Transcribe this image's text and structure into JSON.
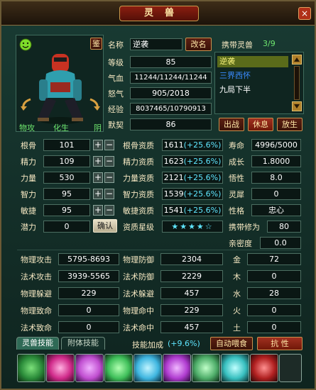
{
  "window": {
    "title": "灵兽",
    "close_label": "×"
  },
  "left": {
    "appraise_label": "鉴",
    "element_type": "物攻",
    "evolve_label": "化生",
    "element_yin": "阴"
  },
  "info": {
    "name_label": "名称",
    "name_value": "逆袭",
    "rename_label": "改名",
    "level_label": "等级",
    "level_value": "85",
    "hp_label": "气血",
    "hp_value": "11244/11244/11244",
    "rage_label": "怒气",
    "rage_value": "905/2018",
    "exp_label": "经验",
    "exp_value": "8037465/10790913",
    "tacit_label": "默契",
    "tacit_value": "86"
  },
  "carry": {
    "title": "携带灵兽",
    "count": "3/9",
    "items": [
      {
        "name": "逆袭",
        "color": "#f7f27a"
      },
      {
        "name": "三界西怀",
        "color": "#3a8cff"
      },
      {
        "name": "九局下半",
        "color": "#ffffff"
      }
    ]
  },
  "actions": {
    "battle": "出战",
    "rest": "休息",
    "release": "放生"
  },
  "base_stats": [
    {
      "label": "根骨",
      "value": "101"
    },
    {
      "label": "精力",
      "value": "109"
    },
    {
      "label": "力量",
      "value": "530"
    },
    {
      "label": "智力",
      "value": "95"
    },
    {
      "label": "敏捷",
      "value": "95"
    }
  ],
  "potential": {
    "label": "潜力",
    "value": "0",
    "confirm": "确认"
  },
  "aptitudes": [
    {
      "label": "根骨资质",
      "value": "1611",
      "bonus": "(+25.6%)"
    },
    {
      "label": "精力资质",
      "value": "1623",
      "bonus": "(+25.6%)"
    },
    {
      "label": "力量资质",
      "value": "2121",
      "bonus": "(+25.6%)"
    },
    {
      "label": "智力资质",
      "value": "1539",
      "bonus": "(+25.6%)"
    },
    {
      "label": "敏捷资质",
      "value": "1541",
      "bonus": "(+25.6%)"
    }
  ],
  "star_level": {
    "label": "资质星级",
    "stars": "★★★★☆"
  },
  "right_stats": [
    {
      "label": "寿命",
      "value": "4996/5000"
    },
    {
      "label": "成长",
      "value": "1.8000"
    },
    {
      "label": "悟性",
      "value": "8.0"
    },
    {
      "label": "灵犀",
      "value": "0"
    },
    {
      "label": "性格",
      "value": "忠心"
    },
    {
      "label": "携带修为",
      "value": "80"
    },
    {
      "label": "亲密度",
      "value": "0.0"
    }
  ],
  "combat_left": [
    {
      "label": "物理攻击",
      "value": "5795-8693"
    },
    {
      "label": "法术攻击",
      "value": "3939-5565"
    },
    {
      "label": "物理躲避",
      "value": "229"
    },
    {
      "label": "物理致命",
      "value": "0"
    },
    {
      "label": "法术致命",
      "value": "0"
    }
  ],
  "combat_mid": [
    {
      "label": "物理防御",
      "value": "2304"
    },
    {
      "label": "法术防御",
      "value": "2229"
    },
    {
      "label": "法术躲避",
      "value": "457"
    },
    {
      "label": "物理命中",
      "value": "229"
    },
    {
      "label": "法术命中",
      "value": "457"
    }
  ],
  "elements": [
    {
      "label": "金",
      "value": "72"
    },
    {
      "label": "木",
      "value": "0"
    },
    {
      "label": "水",
      "value": "28"
    },
    {
      "label": "火",
      "value": "0"
    },
    {
      "label": "土",
      "value": "0"
    }
  ],
  "skills_bar": {
    "tab_skills": "灵兽技能",
    "tab_attached": "附体技能",
    "bonus_label": "技能加成",
    "bonus_value": "(+9.6%)",
    "auto_feed": "自动喂食",
    "resist": "抗 性"
  },
  "skill_icons": [
    {
      "name": "poison-cloud-skill-icon",
      "color": "#2b8c3a"
    },
    {
      "name": "fire-lotus-skill-icon",
      "color": "#d02a8a"
    },
    {
      "name": "healing-bell-skill-icon",
      "color": "#c04ed0"
    },
    {
      "name": "wind-coil-skill-icon",
      "color": "#3fbf5a"
    },
    {
      "name": "ice-claw-skill-icon",
      "color": "#3fb6e0"
    },
    {
      "name": "arcane-burst-skill-icon",
      "color": "#b03cd0"
    },
    {
      "name": "jade-armor-skill-icon",
      "color": "#4fae6a"
    },
    {
      "name": "frost-shard-skill-icon",
      "color": "#38c0c0"
    },
    {
      "name": "blood-skull-skill-icon",
      "color": "#b02020"
    },
    {
      "name": "empty-skill-slot-icon",
      "color": "#1d2b27"
    }
  ]
}
